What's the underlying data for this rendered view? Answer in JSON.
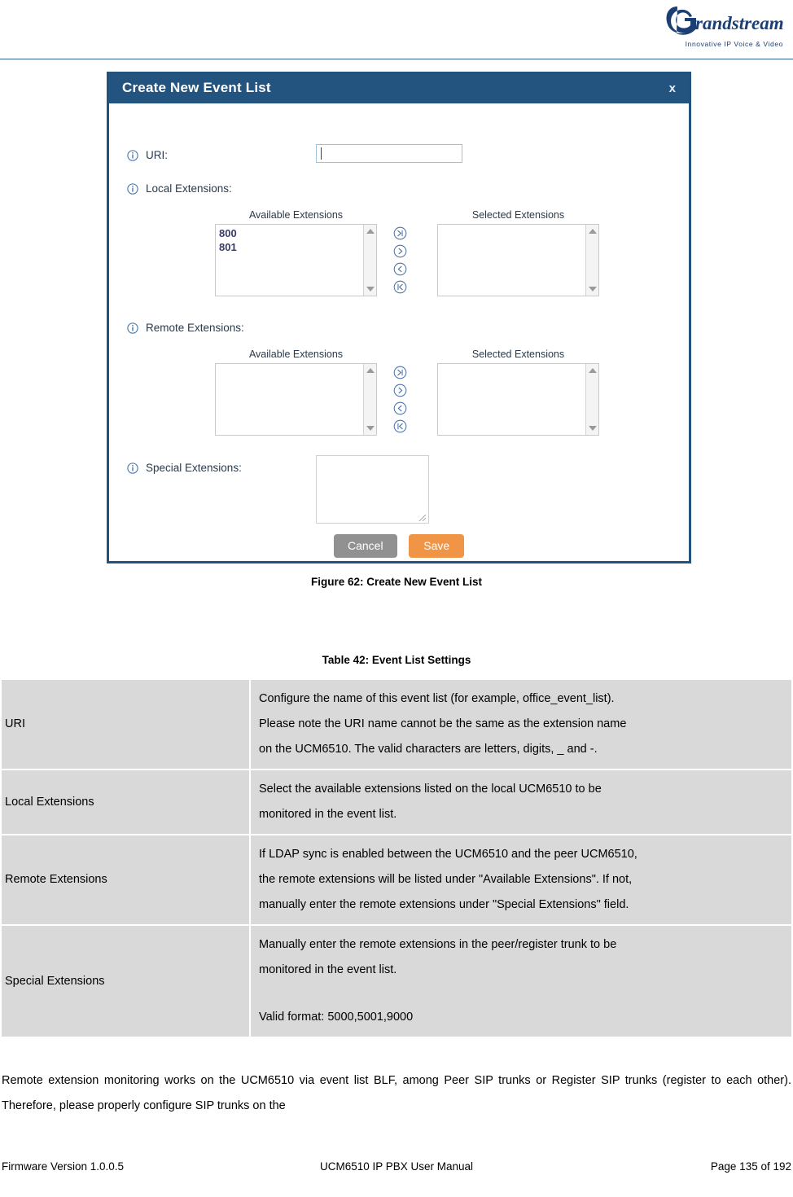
{
  "header": {
    "logo_text": "randstream",
    "logo_tagline": "Innovative IP Voice & Video"
  },
  "dialog": {
    "title": "Create New Event List",
    "close_label": "x",
    "fields": {
      "uri_label": "URI:",
      "uri_value": "",
      "local_label": "Local Extensions:",
      "remote_label": "Remote Extensions:",
      "special_label": "Special Extensions:",
      "special_value": ""
    },
    "local": {
      "available_heading": "Available Extensions",
      "selected_heading": "Selected Extensions",
      "available_items": [
        "800",
        "801"
      ],
      "selected_items": []
    },
    "remote": {
      "available_heading": "Available Extensions",
      "selected_heading": "Selected Extensions",
      "available_items": [],
      "selected_items": []
    },
    "transfer_buttons": [
      {
        "name": "move-all-right",
        "glyph": "≫"
      },
      {
        "name": "move-right",
        "glyph": "›"
      },
      {
        "name": "move-left",
        "glyph": "‹"
      },
      {
        "name": "move-all-left",
        "glyph": "≪"
      }
    ],
    "actions": {
      "cancel_label": "Cancel",
      "save_label": "Save"
    },
    "colors": {
      "titlebar": "#23547f",
      "border": "#23527c",
      "save_button": "#ef9545",
      "cancel_button": "#919191"
    }
  },
  "figure_caption": "Figure 62: Create New Event List",
  "table_caption": "Table 42: Event List Settings",
  "settings_table": {
    "rows": [
      {
        "name": "URI",
        "lines": [
          "Configure the name of this event list (for example, office_event_list).",
          "Please note the URI name cannot be the same as the extension name",
          "on the UCM6510. The valid characters are letters, digits, _ and -."
        ]
      },
      {
        "name": "Local Extensions",
        "lines": [
          "Select the available extensions listed on the local UCM6510 to be",
          "monitored in the event list."
        ]
      },
      {
        "name": "Remote Extensions",
        "lines": [
          "If LDAP sync is enabled between the UCM6510 and the peer UCM6510,",
          "the remote extensions will be listed under \"Available Extensions\". If not,",
          "manually enter the remote extensions under \"Special Extensions\" field."
        ]
      },
      {
        "name": "Special Extensions",
        "lines": [
          "Manually enter the remote extensions in the peer/register trunk to be",
          "monitored in the event list.",
          "",
          "Valid format: 5000,5001,9000"
        ]
      }
    ]
  },
  "body_paragraph": "Remote extension monitoring works on the UCM6510 via event list BLF, among Peer SIP trunks or Register SIP trunks (register to each other). Therefore, please properly configure SIP trunks on the",
  "footer": {
    "left": "Firmware Version 1.0.0.5",
    "center": "UCM6510 IP PBX User Manual",
    "right": "Page 135 of 192"
  }
}
